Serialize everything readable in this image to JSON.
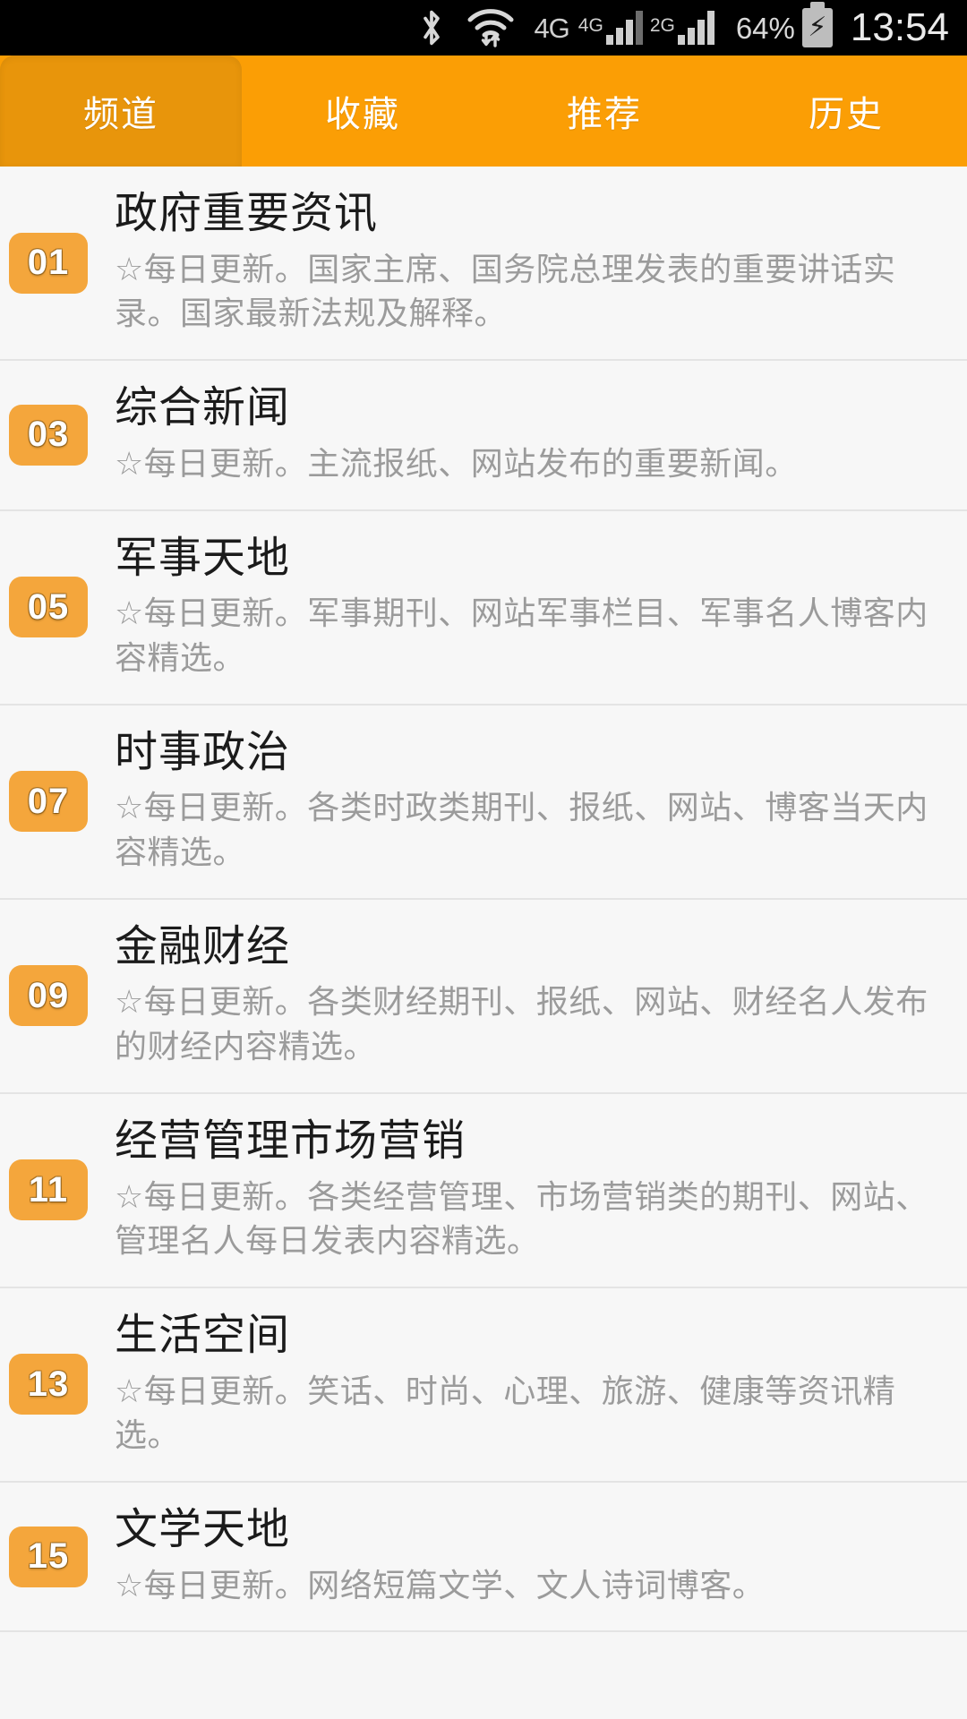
{
  "statusbar": {
    "icons": [
      "bluetooth-icon",
      "wifi-icon",
      "data-transfer-icon",
      "signal-icon",
      "signal-icon",
      "battery-icon"
    ],
    "network_label": "4G",
    "sim1_label": "4G",
    "sim2_label": "2G",
    "battery_percent": "64%",
    "battery_state": "charging",
    "time": "13:54"
  },
  "tabs": [
    {
      "label": "频道",
      "active": true
    },
    {
      "label": "收藏",
      "active": false
    },
    {
      "label": "推荐",
      "active": false
    },
    {
      "label": "历史",
      "active": false
    }
  ],
  "channels": [
    {
      "number": "01",
      "title": "政府重要资讯",
      "desc": "☆每日更新。国家主席、国务院总理发表的重要讲话实录。国家最新法规及解释。"
    },
    {
      "number": "03",
      "title": "综合新闻",
      "desc": "☆每日更新。主流报纸、网站发布的重要新闻。"
    },
    {
      "number": "05",
      "title": "军事天地",
      "desc": "☆每日更新。军事期刊、网站军事栏目、军事名人博客内容精选。"
    },
    {
      "number": "07",
      "title": "时事政治",
      "desc": "☆每日更新。各类时政类期刊、报纸、网站、博客当天内容精选。"
    },
    {
      "number": "09",
      "title": "金融财经",
      "desc": "☆每日更新。各类财经期刊、报纸、网站、财经名人发布的财经内容精选。"
    },
    {
      "number": "11",
      "title": "经营管理市场营销",
      "desc": "☆每日更新。各类经营管理、市场营销类的期刊、网站、管理名人每日发表内容精选。"
    },
    {
      "number": "13",
      "title": "生活空间",
      "desc": "☆每日更新。笑话、时尚、心理、旅游、健康等资讯精选。"
    },
    {
      "number": "15",
      "title": "文学天地",
      "desc": "☆每日更新。网络短篇文学、文人诗词博客。"
    }
  ],
  "colors": {
    "accent": "#fb9e05",
    "accent_active_tab": "#e8950b",
    "badge": "#f4a63c",
    "page_bg": "#f6f6f6",
    "title_text": "#1b1b1b",
    "desc_text": "#9b9b9b",
    "statusbar_bg": "#000000"
  }
}
